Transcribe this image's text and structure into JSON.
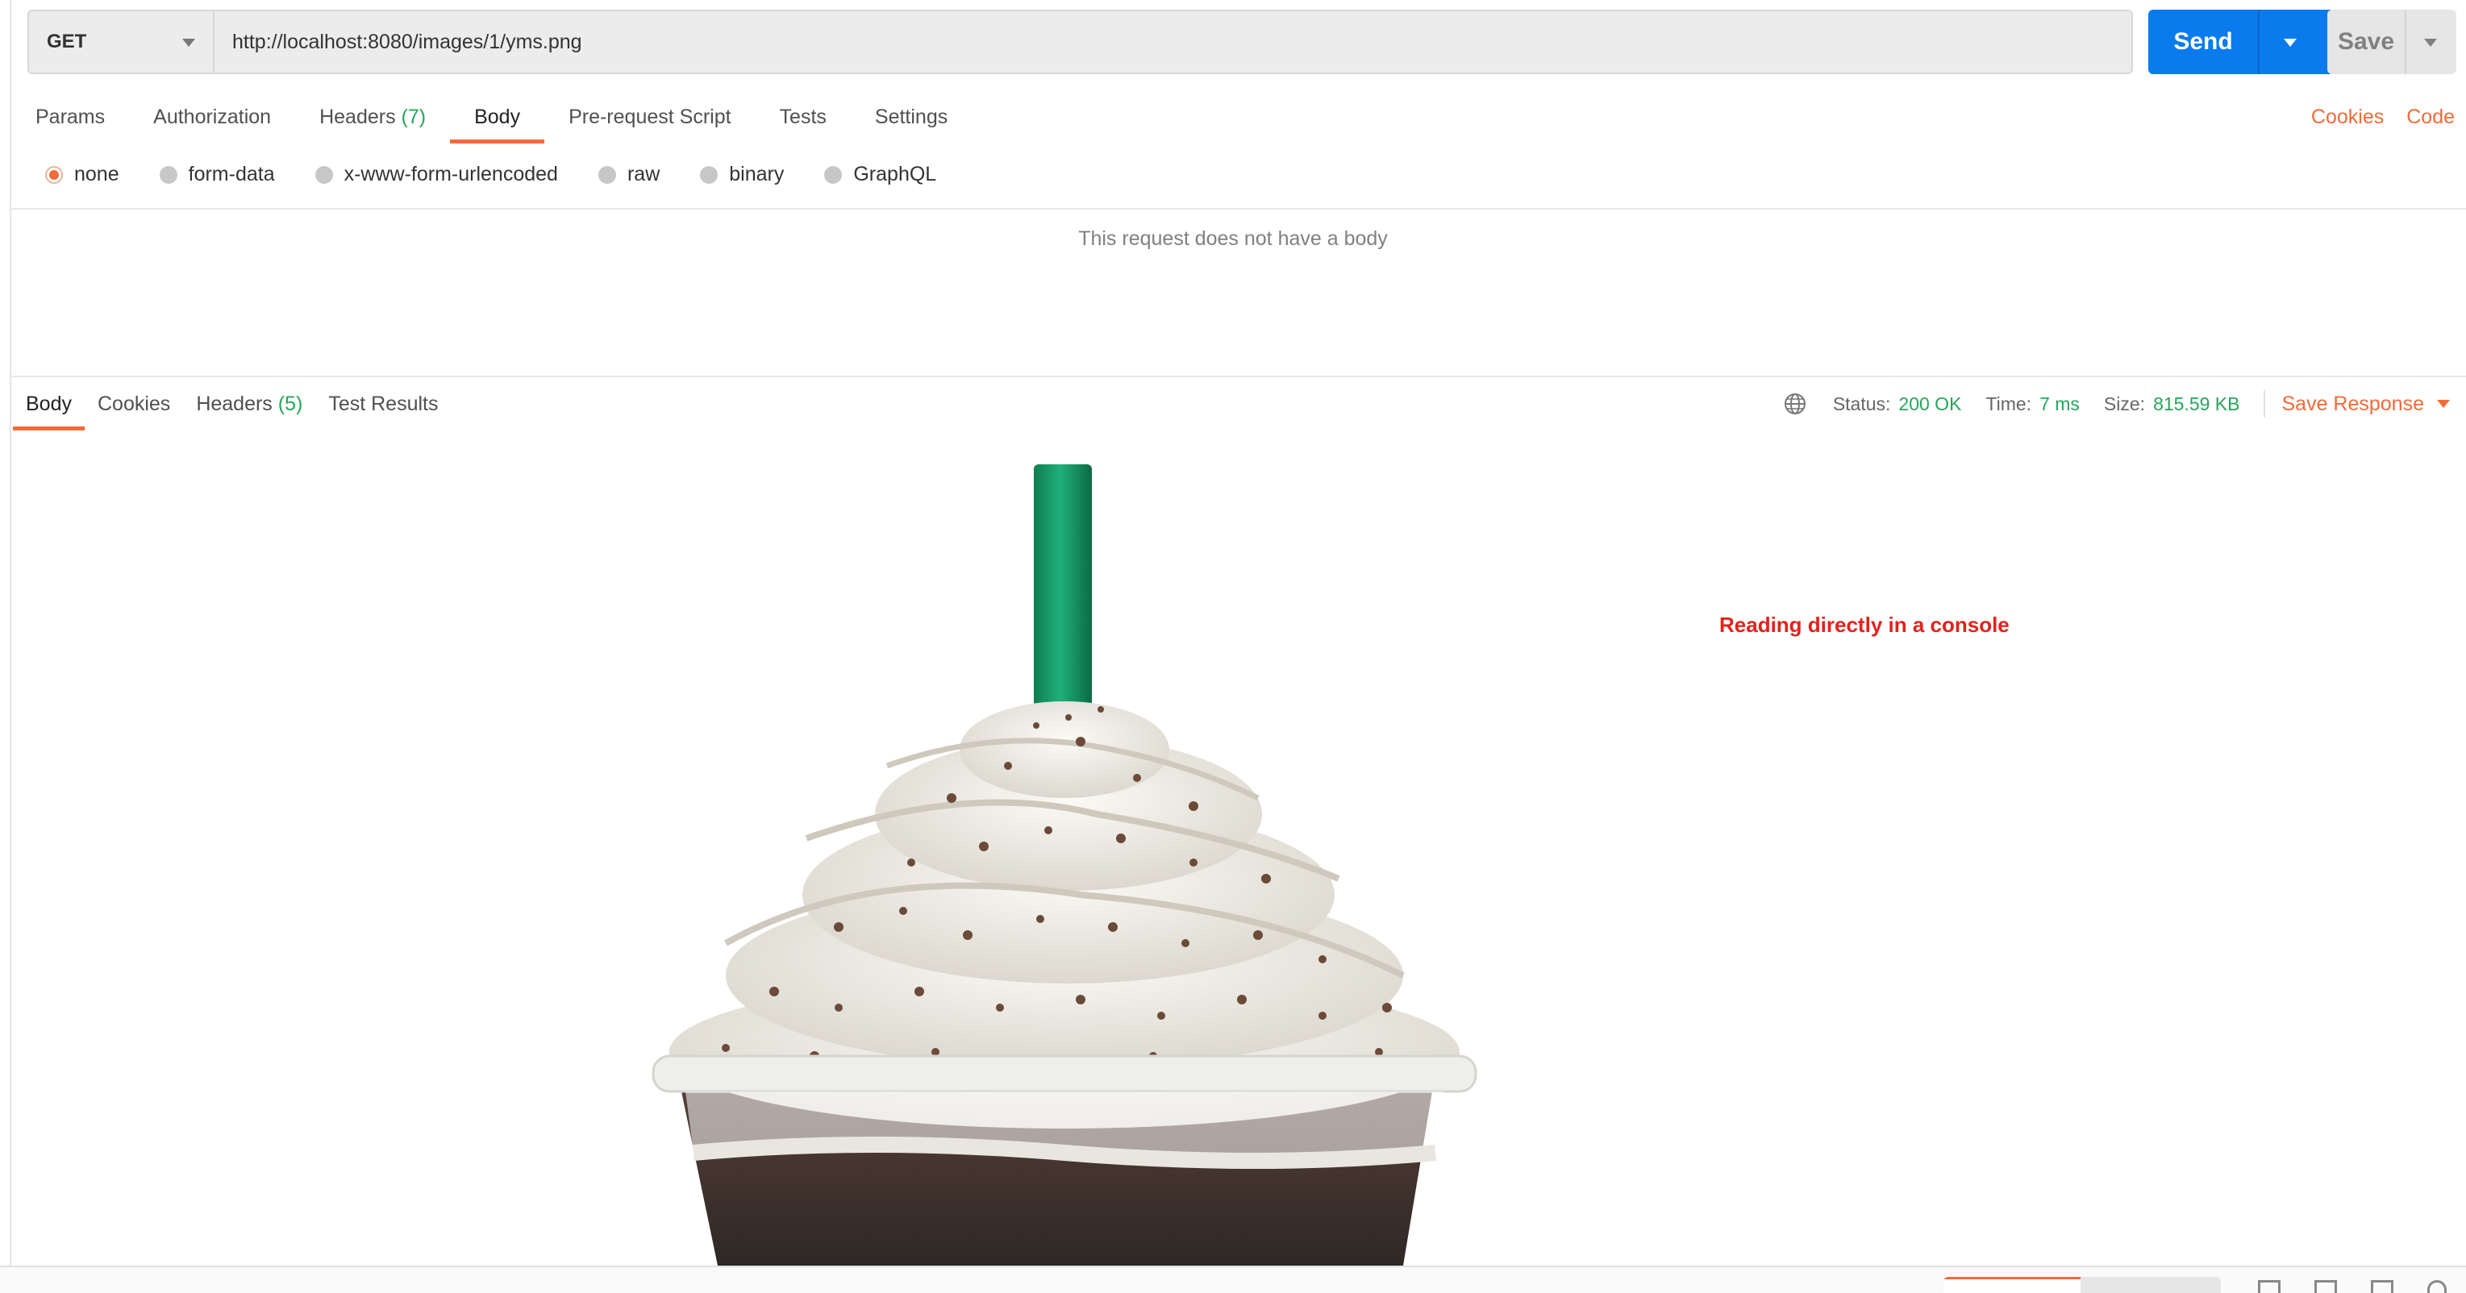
{
  "request": {
    "method": "GET",
    "url": "http://localhost:8080/images/1/yms.png",
    "send_label": "Send",
    "save_label": "Save"
  },
  "request_tabs": {
    "params": "Params",
    "authorization": "Authorization",
    "headers": "Headers",
    "headers_count": "(7)",
    "body": "Body",
    "prerequest": "Pre-request Script",
    "tests": "Tests",
    "settings": "Settings",
    "cookies": "Cookies",
    "code": "Code"
  },
  "body_types": {
    "none": "none",
    "form_data": "form-data",
    "urlencoded": "x-www-form-urlencoded",
    "raw": "raw",
    "binary": "binary",
    "graphql": "GraphQL",
    "selected": "none"
  },
  "no_body_message": "This request does not have a body",
  "response_tabs": {
    "body": "Body",
    "cookies": "Cookies",
    "headers": "Headers",
    "headers_count": "(5)",
    "test_results": "Test Results"
  },
  "response_meta": {
    "status_label": "Status:",
    "status_value": "200 OK",
    "time_label": "Time:",
    "time_value": "7 ms",
    "size_label": "Size:",
    "size_value": "815.59 KB",
    "save_response": "Save Response"
  },
  "preview": {
    "image_subject": "frappuccino-with-whipped-cream-and-green-straw",
    "caption": "Reading directly in a console"
  },
  "colors": {
    "accent": "#f26b3a",
    "send": "#097bed",
    "ok": "#26a65b",
    "caption": "#e2231a"
  }
}
